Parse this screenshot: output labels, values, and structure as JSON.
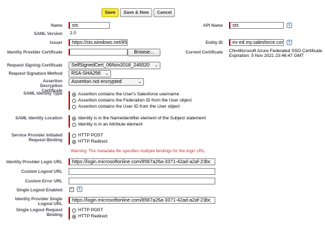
{
  "toolbar": {
    "save": "Save",
    "save_new": "Save & New",
    "cancel": "Cancel"
  },
  "fields": {
    "name": {
      "label": "Name",
      "value": "sts"
    },
    "api_name": {
      "label": "API Name",
      "value": "sts"
    },
    "saml_version": {
      "label": "SAML Version",
      "value": "2.0"
    },
    "issuer": {
      "label": "Issuer",
      "value": "https://sts.windows.net/85"
    },
    "entity_id": {
      "label": "Entity ID",
      "value": "ev-ed.my.salesforce.com"
    },
    "idp_cert": {
      "label": "Identity Provider Certificate",
      "button": "Browse..."
    },
    "current_cert": {
      "label": "Current Certificate",
      "line1": "CN=Microsoft Azure Federated SSO Certificate",
      "line2": "Expiration: 5 Nov 2021 23:46:47 GMT"
    },
    "request_signing_cert": {
      "label": "Request Signing Certificate",
      "value": "SelfSignedCert_06Nov2018_240020"
    },
    "request_signature_method": {
      "label": "Request Signature Method",
      "value": "RSA-SHA256"
    },
    "assertion_decryption_cert": {
      "label": "Assertion Decryption Certificate",
      "value": "Assertion not encrypted"
    },
    "saml_identity_type": {
      "label": "SAML Identity Type",
      "options": [
        "Assertion contains the User's Salesforce username",
        "Assertion contains the Federation ID from the User object",
        "Assertion contains the User ID from the User object"
      ],
      "selected": 0
    },
    "saml_identity_location": {
      "label": "SAML Identity Location",
      "options": [
        "Identity is in the NameIdentifier element of the Subject statement",
        "Identity is in an Attribute element"
      ],
      "selected": 0
    },
    "sp_binding": {
      "label": "Service Provider Initiated Request Binding",
      "options": [
        "HTTP POST",
        "HTTP Redirect"
      ],
      "selected": 1
    },
    "binding_warning": "Warning: The metadata file specifies multiple bindings for the login URL.",
    "idp_login_url": {
      "label": "Identity Provider Login URL",
      "value": "https://login.microsoftonline.com/8567a26a-3371-42ad-a2af-23bc"
    },
    "custom_logout_url": {
      "label": "Custom Logout URL",
      "value": ""
    },
    "custom_error_url": {
      "label": "Custom Error URL",
      "value": ""
    },
    "single_logout_enabled": {
      "label": "Single Logout Enabled",
      "checked": true,
      "mark": "✓"
    },
    "idp_single_logout_url": {
      "label": "Identity Provider Single Logout URL",
      "value": "https://login.microsoftonline.com/8567a26a-3371-42ad-a2af-23bc"
    },
    "single_logout_binding": {
      "label": "Single Logout Request Binding",
      "options": [
        "HTTP POST",
        "HTTP Redirect"
      ],
      "selected": 1
    }
  },
  "icons": {
    "info": "i",
    "chevron": "⌄"
  },
  "colors": {
    "required": "#cc0000",
    "warning": "#c23934",
    "save_button": "#f7e84a"
  }
}
